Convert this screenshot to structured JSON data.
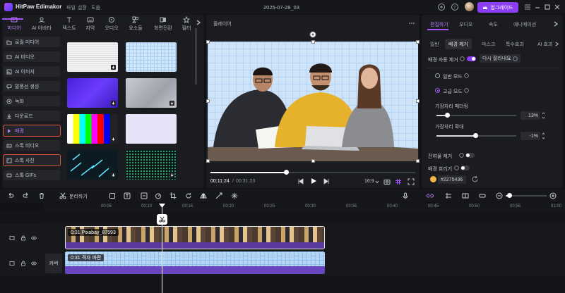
{
  "app": {
    "name": "HitPaw Edimakor",
    "menu": [
      "파일",
      "설정",
      "도움"
    ],
    "document_title": "2025-07-28_03",
    "upgrade_label": "업그레이드"
  },
  "left_panel": {
    "top_tabs": [
      "미디어",
      "AI 아바타",
      "텍스트",
      "자막",
      "오디오",
      "요소들",
      "화면전환",
      "필터"
    ],
    "active_tab": "미디어",
    "items": [
      "로컬 미디어",
      "AI 비디오",
      "AI 이미지",
      "말풍선 생성",
      "녹화",
      "다운로드",
      "배경",
      "스톡 비디오",
      "스톡 사진",
      "스톡 GIFs"
    ],
    "selected_item": "배경",
    "highlighted_items": [
      "배경",
      "스톡 사진"
    ]
  },
  "player": {
    "title": "플레이어",
    "current_time": "00:11:24",
    "total_time": "00:31:23",
    "aspect": "16:9"
  },
  "right_panel": {
    "tabs": [
      "편집하기",
      "오디오",
      "속도",
      "애니메이션"
    ],
    "active_tab": "편집하기",
    "sub_tabs": [
      "일반",
      "배경 제거",
      "마스크",
      "특수효과",
      "AI 효과"
    ],
    "active_sub_tab": "배경 제거",
    "auto_remove_label": "배경 자동 제거",
    "auto_remove_on": true,
    "retry_label": "다시 잘라내요",
    "normal_mode_label": "일반 모드",
    "advanced_mode_label": "고급 모드",
    "selected_mode": "advanced",
    "edge_feather_label": "가장자리 페더링",
    "edge_feather_value": "13%",
    "edge_feather_level": 0.13,
    "edge_expand_label": "가장자리 확대",
    "edge_expand_value": "-1%",
    "edge_expand_level": 0.49,
    "chroma_label": "잔여물 제거",
    "blur_label": "배경 흐리기",
    "color_hex": "#2275436"
  },
  "timeline": {
    "toolbar_split_label": "분리하기",
    "ticks": [
      "00:05",
      "00:10",
      "00:15",
      "00:20",
      "00:25",
      "00:30",
      "00:35",
      "00:40",
      "00:45",
      "00:50",
      "00:55",
      "01:00"
    ],
    "video_clip_label": "0:31 Pixabay_87593",
    "bg_clip_label": "0:31 격자 파란",
    "cover_label": "커버"
  },
  "colors": {
    "accent": "#a855ff",
    "upgrade": "#8b3ef6",
    "highlight_border": "#e0533f"
  }
}
